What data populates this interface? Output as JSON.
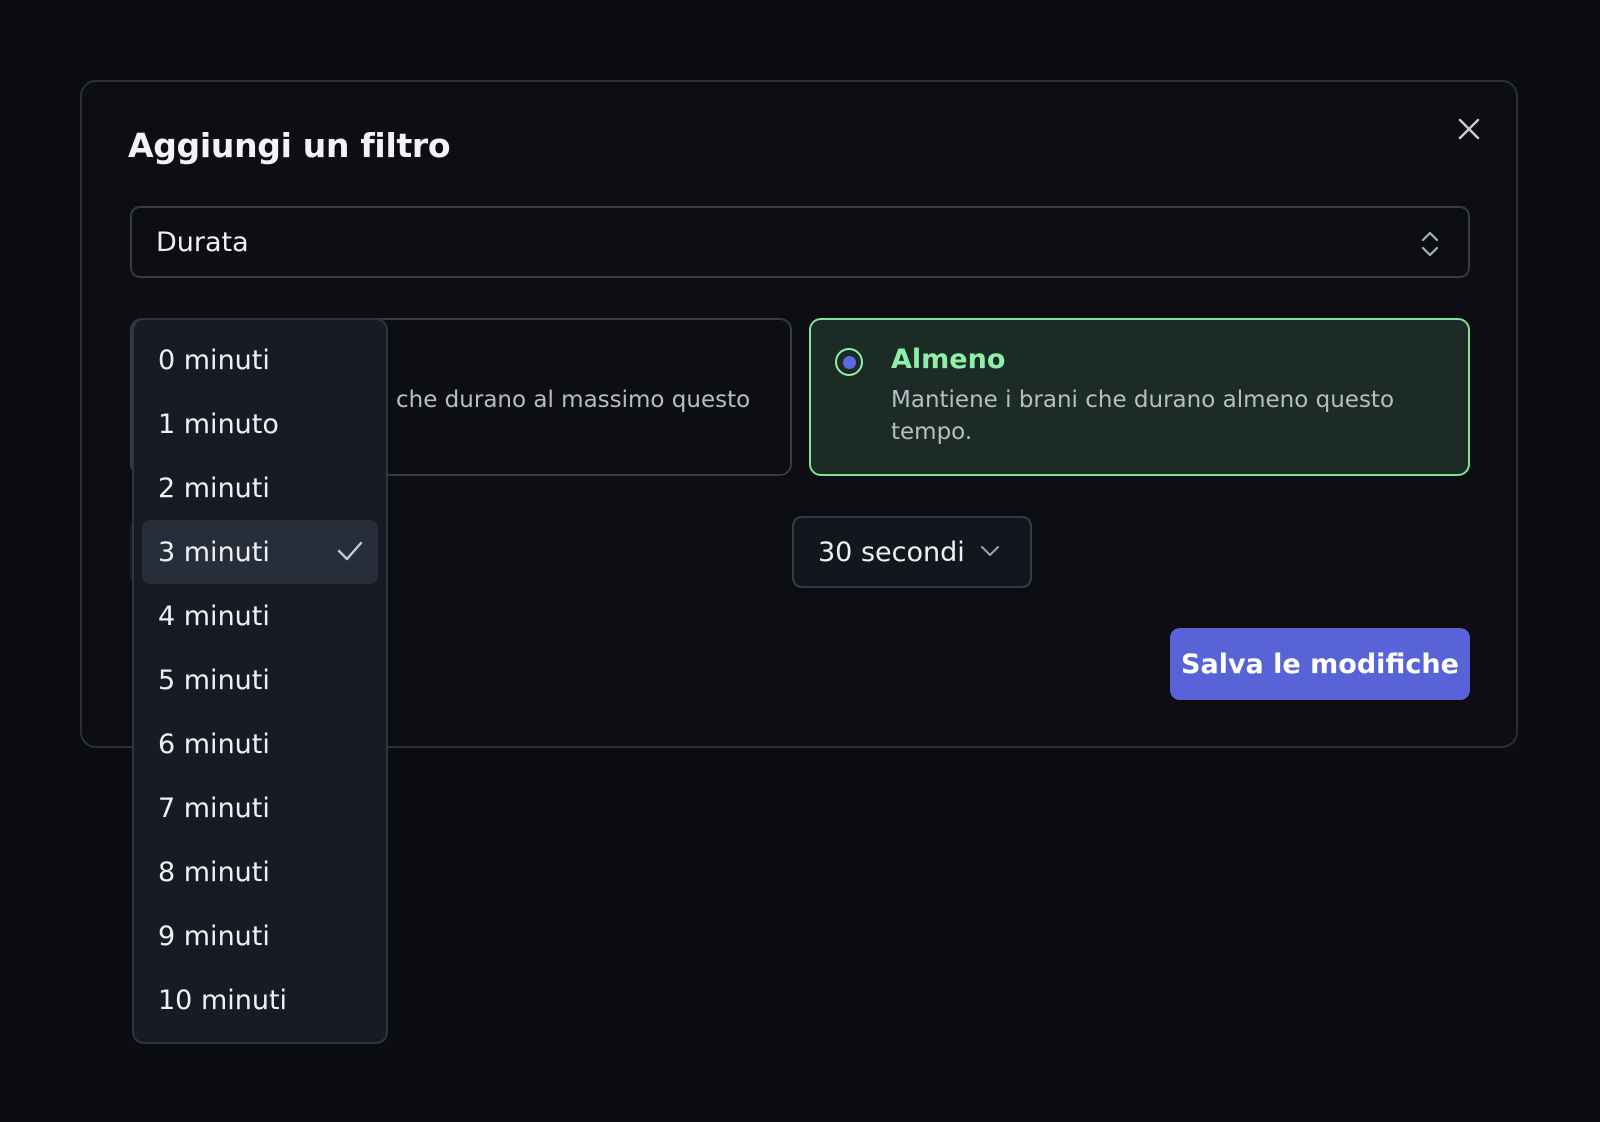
{
  "modal": {
    "title": "Aggiungi un filtro",
    "filter_select": {
      "value": "Durata"
    },
    "options": [
      {
        "label": "",
        "description": "che durano al massimo questo",
        "selected": false
      },
      {
        "label": "Almeno",
        "description": "Mantiene i brani che durano almeno questo tempo.",
        "selected": true
      }
    ],
    "seconds_select": {
      "value": "30 secondi"
    },
    "save_label": "Salva le modifiche"
  },
  "minutes_dropdown": {
    "items": [
      "0 minuti",
      "1 minuto",
      "2 minuti",
      "3 minuti",
      "4 minuti",
      "5 minuti",
      "6 minuti",
      "7 minuti",
      "8 minuti",
      "9 minuti",
      "10 minuti"
    ],
    "selected_index": 3
  },
  "icons": {
    "close": "close-icon",
    "select": "chevron-up-down-icon",
    "dropdown": "chevron-down-icon",
    "selected": "check-icon"
  },
  "colors": {
    "accent": "#5863d8",
    "success": "#8ef0a8",
    "background": "#0b0d12"
  }
}
